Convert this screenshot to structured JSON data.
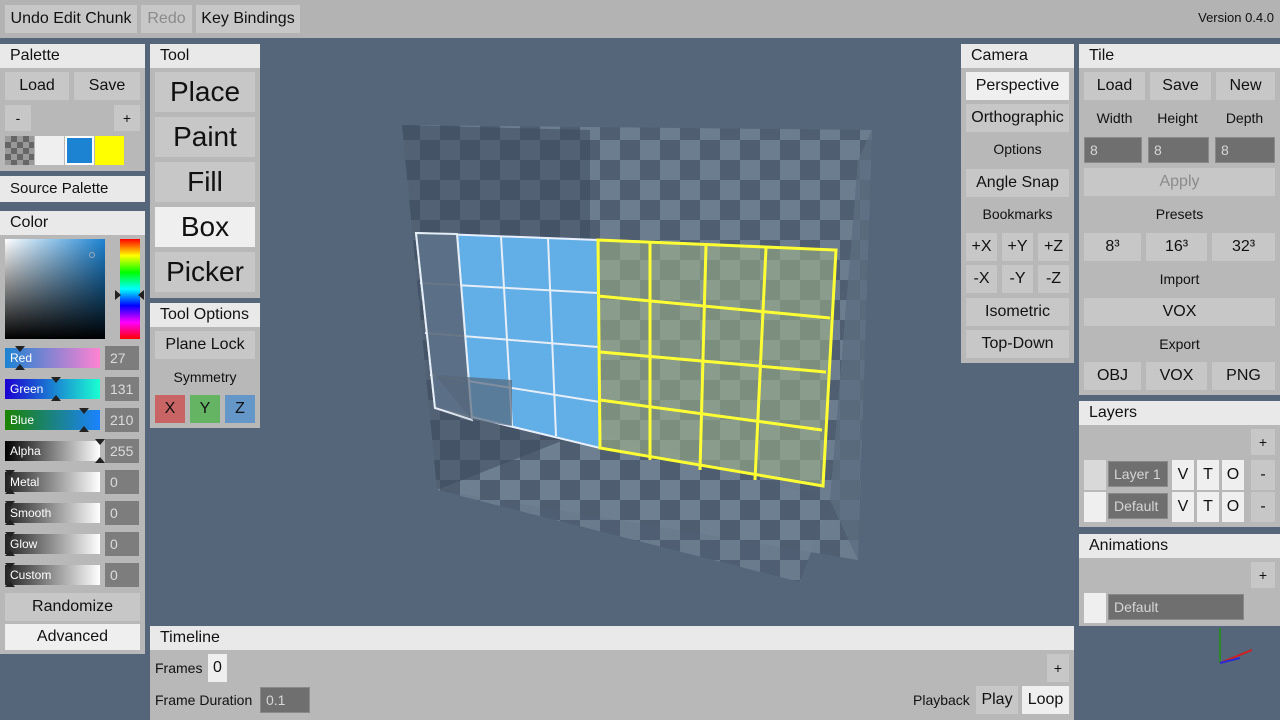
{
  "menu": {
    "undo": "Undo Edit Chunk",
    "redo": "Redo",
    "key_bindings": "Key Bindings",
    "version": "Version 0.4.0"
  },
  "palette": {
    "title": "Palette",
    "load": "Load",
    "save": "Save",
    "minus": "-",
    "plus": "+",
    "swatches": [
      "transparent",
      "#efefef",
      "#1b83d2",
      "#ffff00"
    ],
    "source": "Source Palette"
  },
  "color": {
    "title": "Color",
    "channels": [
      {
        "name": "Red",
        "value": "27",
        "level": 0.106
      },
      {
        "name": "Green",
        "value": "131",
        "level": 0.514
      },
      {
        "name": "Blue",
        "value": "210",
        "level": 0.824
      },
      {
        "name": "Alpha",
        "value": "255",
        "level": 1.0
      },
      {
        "name": "Metal",
        "value": "0",
        "level": 0
      },
      {
        "name": "Smooth",
        "value": "0",
        "level": 0
      },
      {
        "name": "Glow",
        "value": "0",
        "level": 0
      },
      {
        "name": "Custom",
        "value": "0",
        "level": 0
      }
    ],
    "randomize": "Randomize",
    "advanced": "Advanced"
  },
  "tool": {
    "title": "Tool",
    "items": [
      "Place",
      "Paint",
      "Fill",
      "Box",
      "Picker"
    ],
    "active": "Box",
    "options_title": "Tool Options",
    "plane_lock": "Plane Lock",
    "symmetry": "Symmetry",
    "sym": [
      "X",
      "Y",
      "Z"
    ],
    "sym_colors": [
      "#c86464",
      "#64b464",
      "#6496c8"
    ]
  },
  "camera": {
    "title": "Camera",
    "perspective": "Perspective",
    "orthographic": "Orthographic",
    "options": "Options",
    "angle_snap": "Angle Snap",
    "bookmarks": "Bookmarks",
    "axes": [
      "+X",
      "+Y",
      "+Z",
      "-X",
      "-Y",
      "-Z"
    ],
    "isometric": "Isometric",
    "top_down": "Top-Down"
  },
  "tile": {
    "title": "Tile",
    "load": "Load",
    "save": "Save",
    "new": "New",
    "width_label": "Width",
    "height_label": "Height",
    "depth_label": "Depth",
    "width": "8",
    "height": "8",
    "depth": "8",
    "apply": "Apply",
    "presets": "Presets",
    "p8": "8³",
    "p16": "16³",
    "p32": "32³",
    "import": "Import",
    "vox_import": "VOX",
    "export": "Export",
    "obj": "OBJ",
    "vox_export": "VOX",
    "png": "PNG"
  },
  "layers": {
    "title": "Layers",
    "add": "+",
    "rows": [
      {
        "name": "Layer 1",
        "v": "V",
        "t": "T",
        "o": "O",
        "del": "-"
      },
      {
        "name": "Default",
        "v": "V",
        "t": "T",
        "o": "O",
        "del": "-"
      }
    ]
  },
  "animations": {
    "title": "Animations",
    "add": "+",
    "default": "Default"
  },
  "timeline": {
    "title": "Timeline",
    "frames_label": "Frames",
    "frames": "0",
    "add": "+",
    "frame_duration_label": "Frame Duration",
    "frame_duration": "0.1",
    "playback": "Playback",
    "play": "Play",
    "loop": "Loop"
  }
}
